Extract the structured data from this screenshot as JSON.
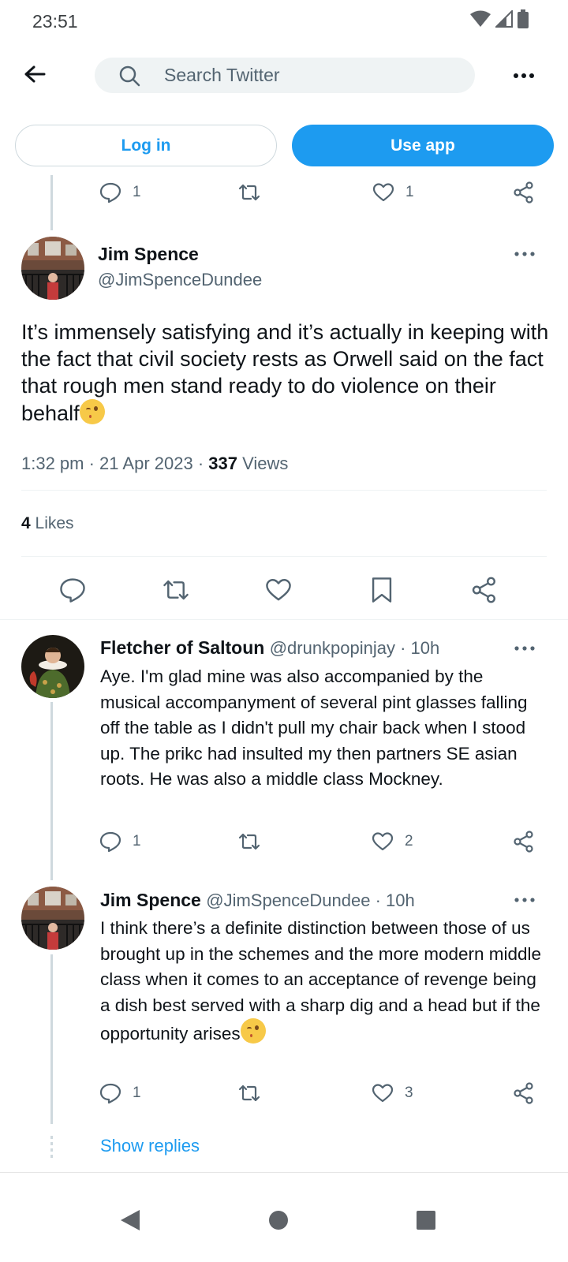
{
  "status": {
    "time": "23:51"
  },
  "search": {
    "placeholder": "Search Twitter"
  },
  "auth": {
    "login_label": "Log in",
    "use_app_label": "Use app"
  },
  "prev_actions": {
    "replies": "1",
    "likes": "1"
  },
  "main_tweet": {
    "name": "Jim Spence",
    "handle": "@JimSpenceDundee",
    "text": "It’s immensely satisfying and it’s actually in keeping with the fact that civil society rests as Orwell said on the fact that rough men stand ready to do violence on their behalf",
    "time": "1:32 pm · 21 Apr 2023 · ",
    "views_count": "337",
    "views_label": " Views",
    "likes_count": "4",
    "likes_label": " Likes"
  },
  "replies": [
    {
      "name": "Fletcher of Saltoun",
      "handle": "@drunkpopinjay · 10h",
      "text": "Aye. I'm glad mine was also accompanied by the musical accompanyment of several pint glasses falling off the table as I didn't pull my chair back when I stood up. The prikc had insulted my then partners SE asian roots. He was also a middle class Mockney.",
      "replies": "1",
      "likes": "2"
    },
    {
      "name": "Jim Spence",
      "handle": "@JimSpenceDundee · 10h",
      "text": "I think there’s a definite distinction between those of us brought up in the schemes and the more modern middle class when it comes to an acceptance of revenge being a dish best served with a sharp dig and a head but if the opportunity arises",
      "replies": "1",
      "likes": "3"
    }
  ],
  "show_replies": "Show replies",
  "colors": {
    "accent": "#1d9bf0",
    "text": "#0f1419",
    "muted": "#536471"
  }
}
